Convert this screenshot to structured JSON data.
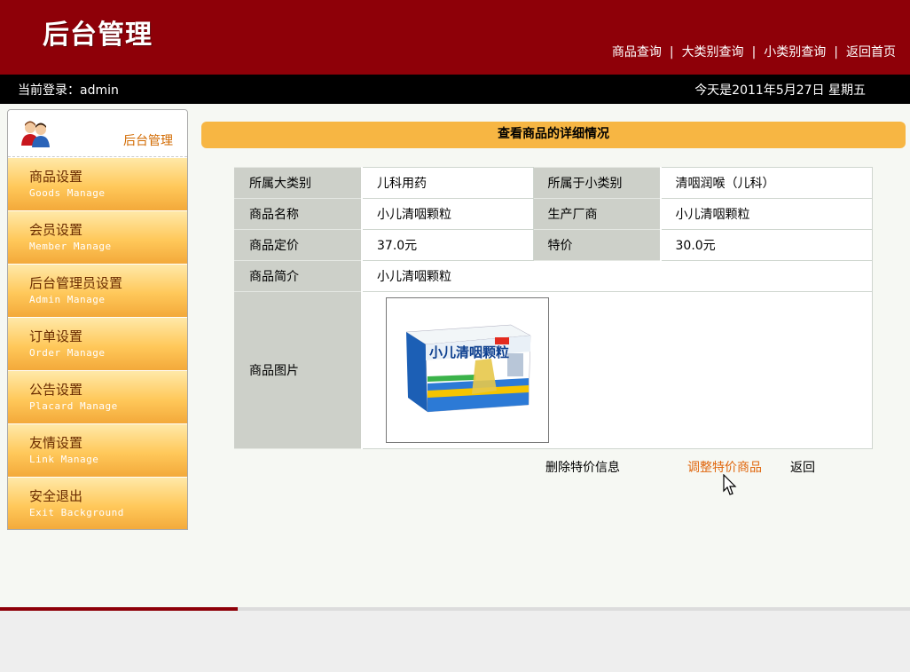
{
  "header": {
    "logo": "后台管理",
    "nav": [
      "商品查询",
      "大类别查询",
      "小类别查询",
      "返回首页"
    ],
    "nav_separator": "|"
  },
  "infobar": {
    "login": "当前登录：admin",
    "date": "今天是2011年5月27日 星期五"
  },
  "sidebar": {
    "title": "后台管理",
    "items": [
      {
        "cn": "商品设置",
        "en": "Goods Manage"
      },
      {
        "cn": "会员设置",
        "en": "Member Manage"
      },
      {
        "cn": "后台管理员设置",
        "en": "Admin Manage"
      },
      {
        "cn": "订单设置",
        "en": "Order Manage"
      },
      {
        "cn": "公告设置",
        "en": "Placard Manage"
      },
      {
        "cn": "友情设置",
        "en": "Link Manage"
      },
      {
        "cn": "安全退出",
        "en": "Exit Background"
      }
    ]
  },
  "main": {
    "title": "查看商品的详细情况",
    "rows": {
      "big_category_label": "所属大类别",
      "big_category": "儿科用药",
      "small_category_label": "所属于小类别",
      "small_category": "清咽润喉（儿科）",
      "name_label": "商品名称",
      "name": "小儿清咽颗粒",
      "maker_label": "生产厂商",
      "maker": "小儿清咽颗粒",
      "price_label": "商品定价",
      "price": "37.0元",
      "special_label": "特价",
      "special": "30.0元",
      "intro_label": "商品简介",
      "intro": "小儿清咽颗粒",
      "image_label": "商品图片",
      "box_text": "小儿清咽颗粒"
    },
    "actions": {
      "delete": "删除特价信息",
      "adjust": "调整特价商品",
      "back": "返回"
    }
  },
  "colors": {
    "header_red": "#8e0008",
    "title_bar": "#f7b643",
    "highlight_link": "#e0660d"
  }
}
